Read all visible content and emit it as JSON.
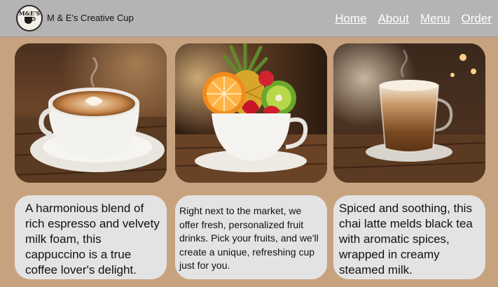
{
  "header": {
    "logo_text": "M&E'S",
    "brand": "M & E's Creative Cup",
    "nav": [
      {
        "label": "Home"
      },
      {
        "label": "About"
      },
      {
        "label": "Menu"
      },
      {
        "label": "Order"
      }
    ]
  },
  "products": [
    {
      "image": "cappuccino-photo",
      "description": "A harmonious blend of rich espresso and velvety milk foam, this cappuccino is a true coffee lover's delight."
    },
    {
      "image": "fruit-cup-photo",
      "description": "Right next to the market, we offer fresh, personalized fruit drinks. Pick your fruits, and we'll create a unique, refreshing cup just for you."
    },
    {
      "image": "chai-latte-photo",
      "description": "Spiced and soothing, this chai latte melds black tea with aromatic spices, wrapped in creamy steamed milk."
    }
  ],
  "colors": {
    "background": "#c7a27f",
    "header": "#b4b4b4",
    "card": "#e3e3e3",
    "nav_text": "#ffffff"
  }
}
